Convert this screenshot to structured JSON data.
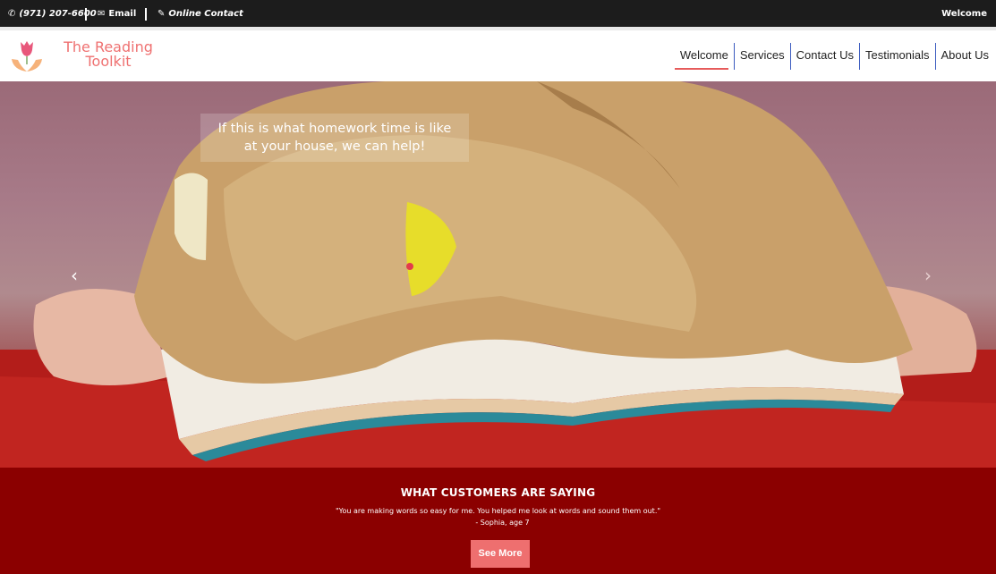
{
  "topbar": {
    "phone": "(971) 207-6600",
    "phone_icon": "phone-icon",
    "email": "Email",
    "email_icon": "envelope-icon",
    "online_contact": "Online Contact",
    "online_contact_icon": "pencil-icon",
    "right_label": "Welcome"
  },
  "header": {
    "logo_text_line1": "The Reading",
    "logo_text_line2": "Toolkit",
    "logo_icon": "tulip-hands-icon",
    "brand_color": "#ef7171",
    "nav": [
      {
        "label": "Welcome",
        "active": true
      },
      {
        "label": "Services",
        "active": false
      },
      {
        "label": "Contact Us",
        "active": false
      },
      {
        "label": "Testimonials",
        "active": false
      },
      {
        "label": "About Us",
        "active": false
      }
    ]
  },
  "hero": {
    "caption_line1": "If this is what homework time is like",
    "caption_line2": "at your house, we can help!",
    "prev_icon": "chevron-left-icon",
    "next_icon": "chevron-right-icon"
  },
  "testimonials": {
    "heading": "WHAT CUSTOMERS ARE SAYING",
    "quote": "\"You are making words so easy for me. You helped me look at words and sound them out.\"",
    "author": "- Sophia, age 7",
    "button": "See More",
    "background": "#8b0000",
    "button_color": "#ee6f6f"
  }
}
